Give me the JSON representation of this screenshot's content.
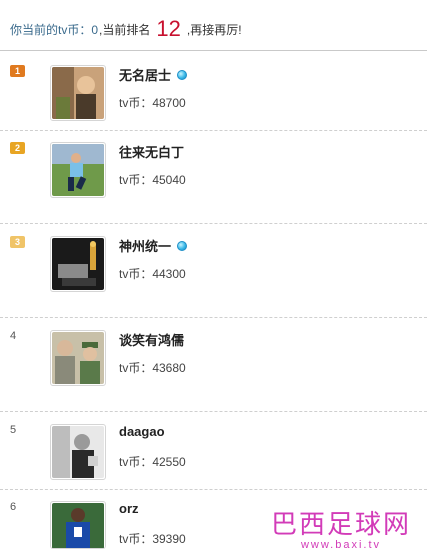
{
  "header": {
    "prefix": "你当前的tv币：",
    "coins": "0",
    "rank_label": ",当前排名",
    "rank": "12",
    "suffix": ",再接再厉!"
  },
  "entries": [
    {
      "badge": "1",
      "name": "无名居士",
      "coins_label": "tv币：48700",
      "vip": true
    },
    {
      "badge": "2",
      "name": "往来无白丁",
      "coins_label": "tv币：45040",
      "vip": false
    },
    {
      "badge": "3",
      "name": "神州统一",
      "coins_label": "tv币：44300",
      "vip": true
    },
    {
      "badge": "4",
      "name": "谈笑有鸿儒",
      "coins_label": "tv币：43680",
      "vip": false
    },
    {
      "badge": "5",
      "name": "daagao",
      "coins_label": "tv币：42550",
      "vip": false
    },
    {
      "badge": "6",
      "name": "orz",
      "coins_label": "tv币：39390",
      "vip": false
    }
  ],
  "watermark": {
    "title": "巴西足球网",
    "url": "www.baxi.tv"
  },
  "colors": {
    "rank_red": "#c8102e",
    "badge_gold": "#e07a1f",
    "badge_silver": "#e8a524",
    "badge_bronze": "#f0c468",
    "watermark": "#d23bb8"
  }
}
